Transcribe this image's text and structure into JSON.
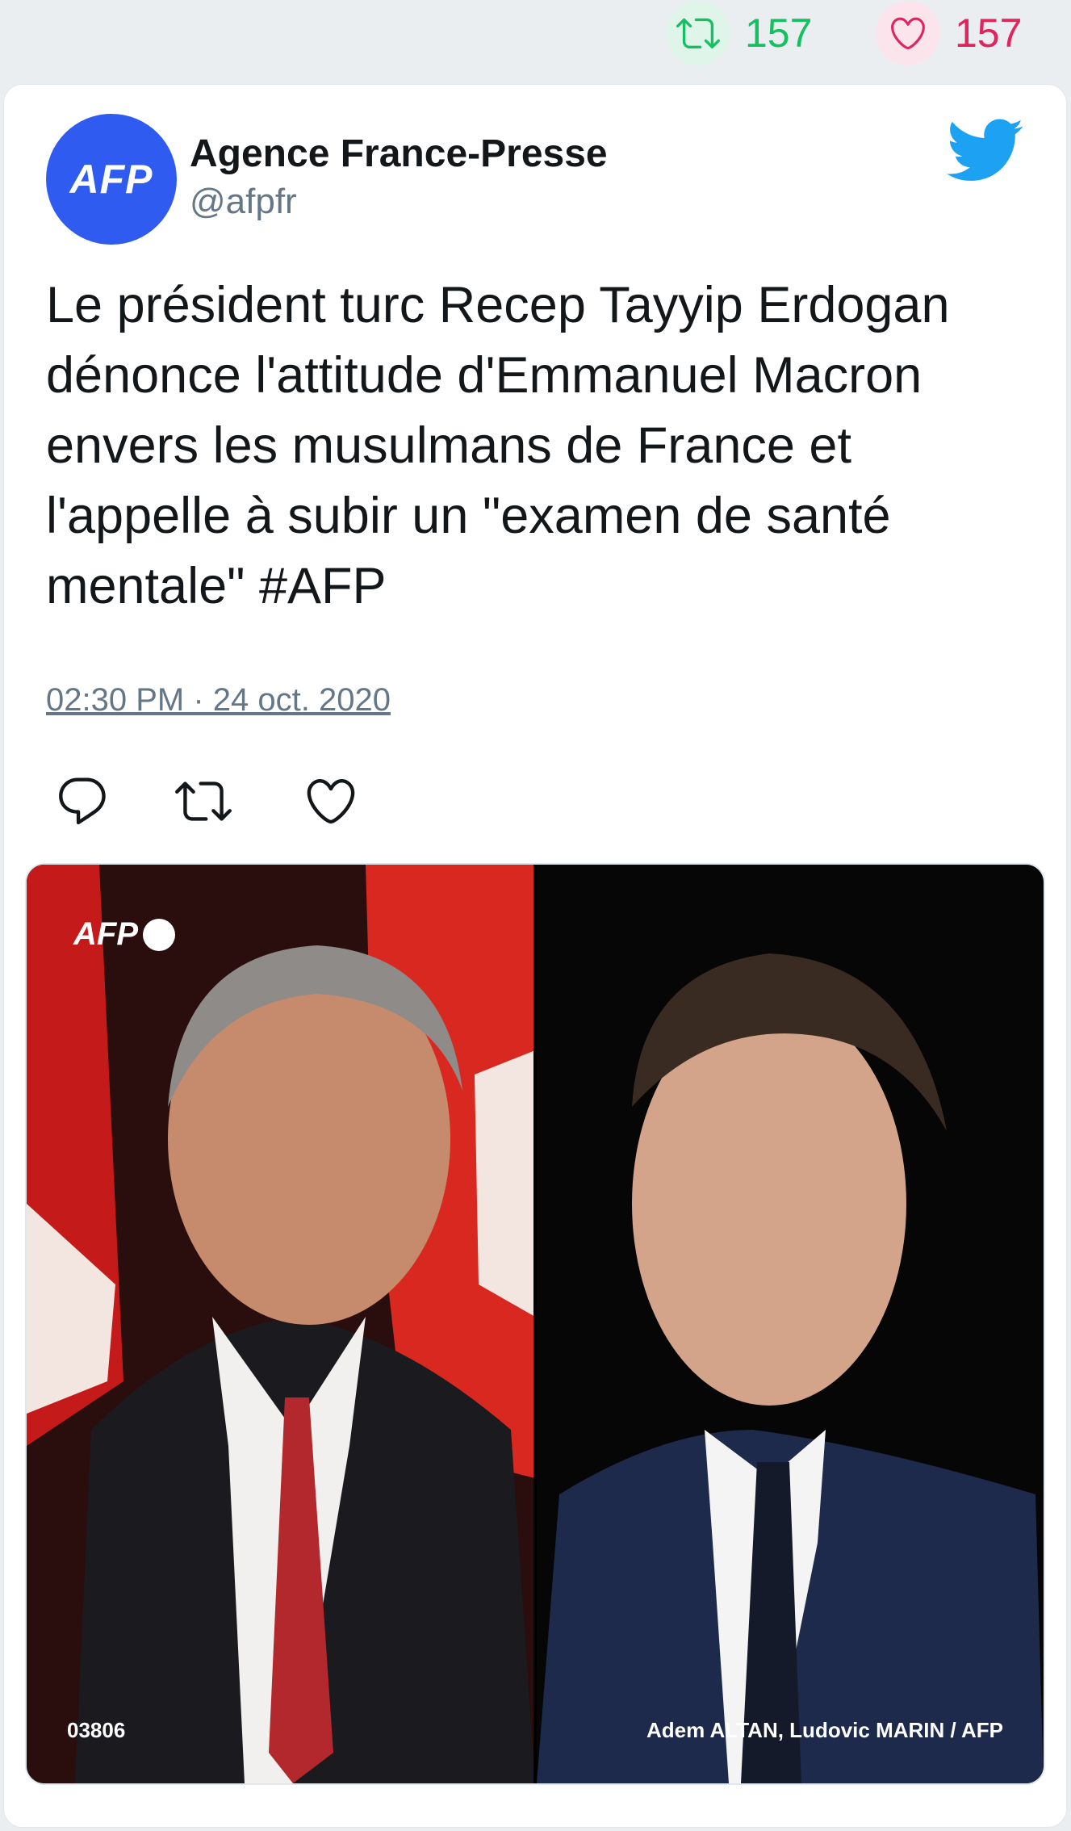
{
  "stats": {
    "retweet_count": "157",
    "like_count": "157",
    "retweet_color": "#17bf63",
    "like_color": "#e0245e"
  },
  "author": {
    "avatar_text": "AFP",
    "name": "Agence France-Presse",
    "handle": "@afpfr",
    "avatar_color": "#2f5bf0"
  },
  "tweet": {
    "text": "Le président turc Recep Tayyip Erdogan dénonce l'attitude d'Emmanuel Macron envers les musulmans de France et l'appelle à subir un \"examen de santé mentale\" #AFP",
    "timestamp": "02:30 PM · 24 oct. 2020"
  },
  "actions": {
    "reply_icon": "reply-icon",
    "retweet_icon": "retweet-icon",
    "like_icon": "heart-icon"
  },
  "media": {
    "logo_text": "AFP",
    "photo_id": "03806",
    "credit": "Adem ALTAN, Ludovic MARIN / AFP"
  },
  "brand": {
    "twitter_blue": "#1da1f2"
  }
}
